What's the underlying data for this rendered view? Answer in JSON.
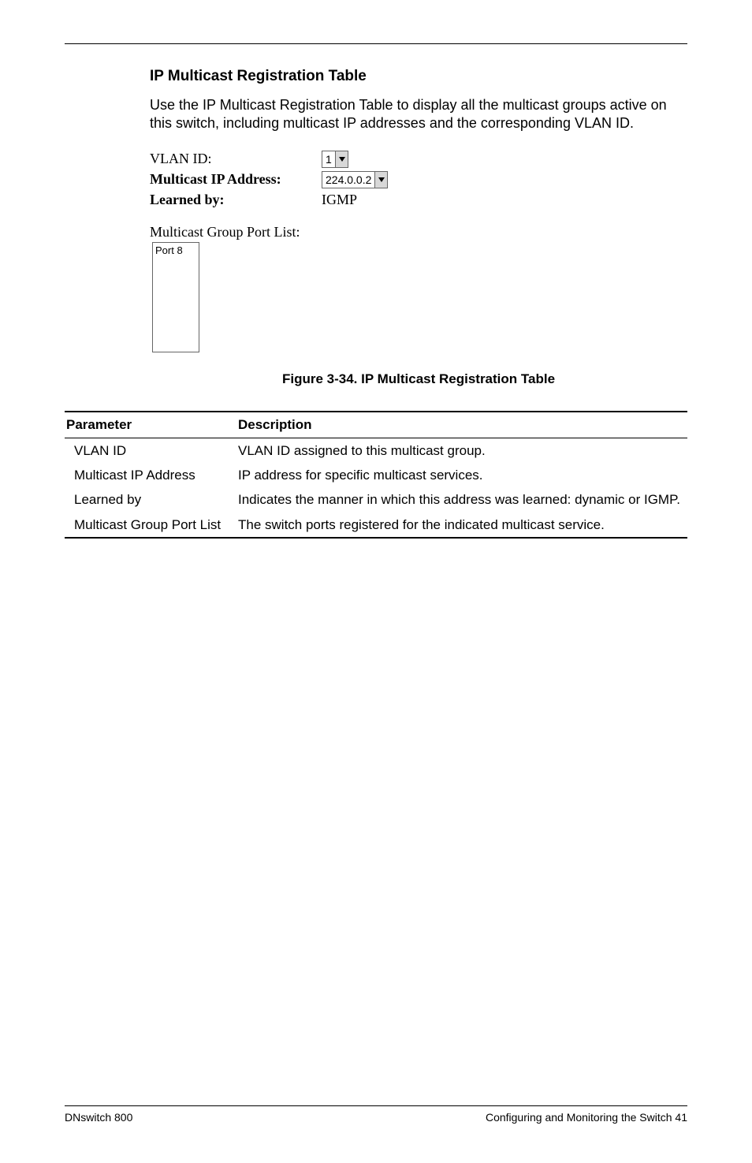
{
  "section_heading": "IP Multicast Registration Table",
  "intro_text": "Use the IP Multicast Registration Table to display all the multicast groups active on this switch, including multicast IP addresses and the corresponding VLAN ID.",
  "form": {
    "vlan_label": "VLAN ID:",
    "vlan_value": "1",
    "mcast_ip_label": "Multicast IP Address:",
    "mcast_ip_value": "224.0.0.2",
    "learned_label": "Learned by:",
    "learned_value": "IGMP",
    "port_list_label": "Multicast Group Port List:",
    "port_list_item": "Port 8"
  },
  "figure_caption": "Figure 3-34.  IP Multicast Registration Table",
  "table": {
    "header_param": "Parameter",
    "header_desc": "Description",
    "rows": [
      {
        "param": "VLAN ID",
        "desc": "VLAN ID assigned to this multicast group."
      },
      {
        "param": "Multicast IP Address",
        "desc": "IP address for specific multicast services."
      },
      {
        "param": "Learned by",
        "desc": "Indicates the manner in which this address was learned: dynamic or IGMP."
      },
      {
        "param": "Multicast Group Port List",
        "desc": "The switch ports registered for the indicated multicast service."
      }
    ]
  },
  "footer": {
    "left": "DNswitch 800",
    "right": "Configuring and Monitoring the Switch  41"
  }
}
